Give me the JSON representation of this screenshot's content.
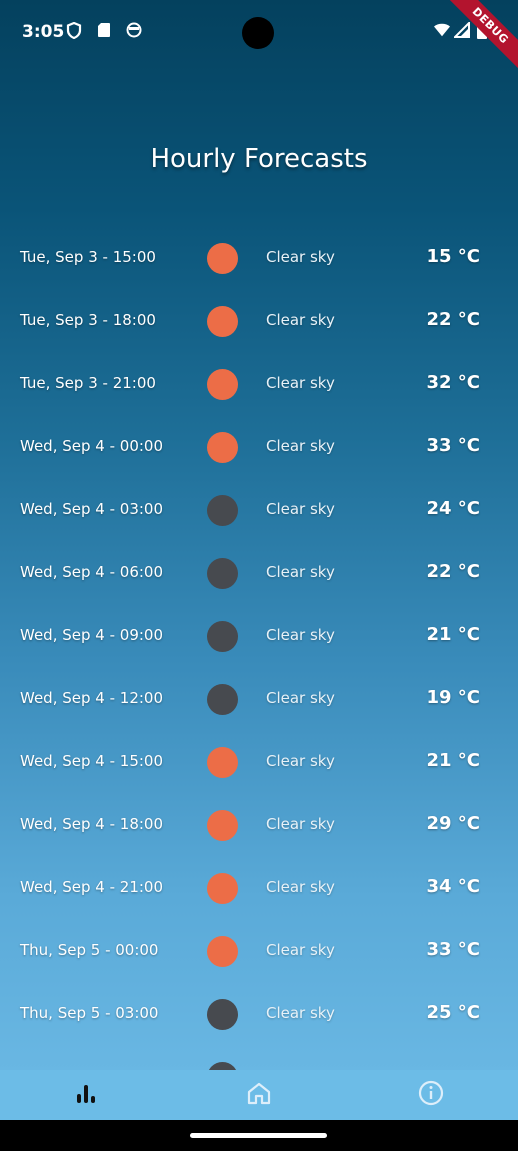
{
  "status_bar": {
    "time": "3:05",
    "left_icons": [
      "shield-icon",
      "sd-card-icon",
      "face-icon"
    ],
    "right_icons": [
      "wifi-icon",
      "signal-icon",
      "battery-icon"
    ]
  },
  "debug_banner": "DEBUG",
  "page": {
    "title": "Hourly Forecasts"
  },
  "colors": {
    "sun": "#ec6d47",
    "moon": "#474a4f"
  },
  "forecasts": [
    {
      "date": "Tue, Sep 3 - 15:00",
      "icon": "sun",
      "description": "Clear sky",
      "temp": "15 °C"
    },
    {
      "date": "Tue, Sep 3 - 18:00",
      "icon": "sun",
      "description": "Clear sky",
      "temp": "22 °C"
    },
    {
      "date": "Tue, Sep 3 - 21:00",
      "icon": "sun",
      "description": "Clear sky",
      "temp": "32 °C"
    },
    {
      "date": "Wed, Sep 4 - 00:00",
      "icon": "sun",
      "description": "Clear sky",
      "temp": "33 °C"
    },
    {
      "date": "Wed, Sep 4 - 03:00",
      "icon": "moon",
      "description": "Clear sky",
      "temp": "24 °C"
    },
    {
      "date": "Wed, Sep 4 - 06:00",
      "icon": "moon",
      "description": "Clear sky",
      "temp": "22 °C"
    },
    {
      "date": "Wed, Sep 4 - 09:00",
      "icon": "moon",
      "description": "Clear sky",
      "temp": "21 °C"
    },
    {
      "date": "Wed, Sep 4 - 12:00",
      "icon": "moon",
      "description": "Clear sky",
      "temp": "19 °C"
    },
    {
      "date": "Wed, Sep 4 - 15:00",
      "icon": "sun",
      "description": "Clear sky",
      "temp": "21 °C"
    },
    {
      "date": "Wed, Sep 4 - 18:00",
      "icon": "sun",
      "description": "Clear sky",
      "temp": "29 °C"
    },
    {
      "date": "Wed, Sep 4 - 21:00",
      "icon": "sun",
      "description": "Clear sky",
      "temp": "34 °C"
    },
    {
      "date": "Thu, Sep 5 - 00:00",
      "icon": "sun",
      "description": "Clear sky",
      "temp": "33 °C"
    },
    {
      "date": "Thu, Sep 5 - 03:00",
      "icon": "moon",
      "description": "Clear sky",
      "temp": "25 °C"
    },
    {
      "date": "",
      "icon": "moon",
      "description": "",
      "temp": ""
    }
  ],
  "bottom_nav": {
    "items": [
      {
        "icon": "bar-chart-icon",
        "active": true
      },
      {
        "icon": "home-icon",
        "active": false
      },
      {
        "icon": "info-icon",
        "active": false
      }
    ]
  }
}
